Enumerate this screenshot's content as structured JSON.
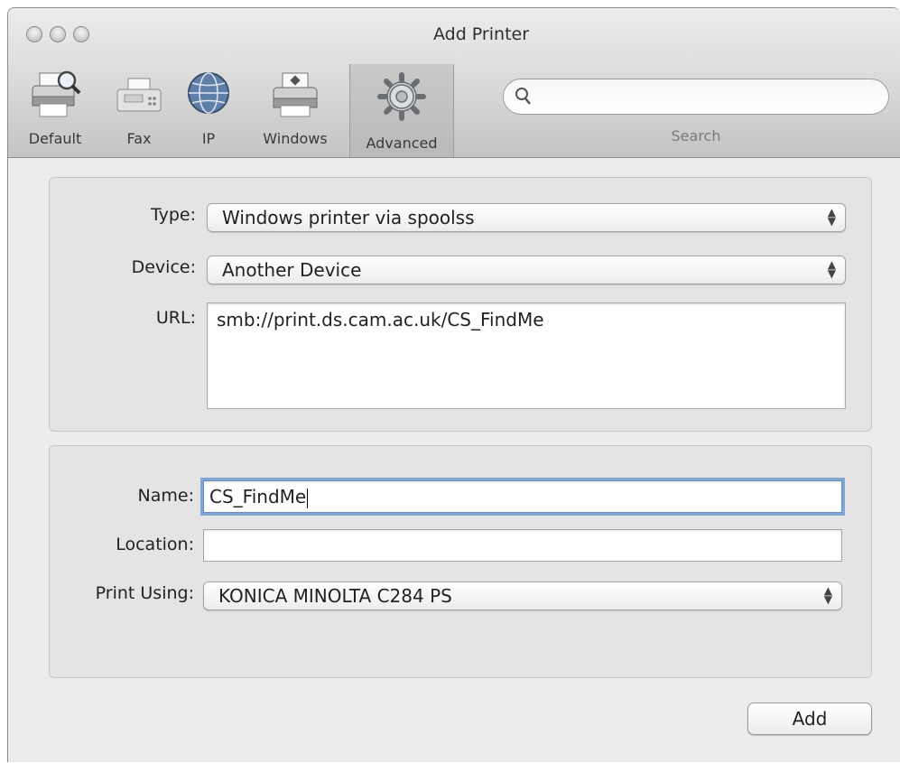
{
  "window": {
    "title": "Add Printer"
  },
  "toolbar": {
    "items": [
      {
        "label": "Default",
        "icon": "default-printer-icon"
      },
      {
        "label": "Fax",
        "icon": "fax-icon"
      },
      {
        "label": "IP",
        "icon": "ip-globe-icon"
      },
      {
        "label": "Windows",
        "icon": "windows-printer-icon"
      },
      {
        "label": "Advanced",
        "icon": "advanced-gear-icon",
        "selected": true
      }
    ],
    "search_label": "Search",
    "search_value": ""
  },
  "connection": {
    "type_label": "Type:",
    "type_value": "Windows printer via spoolss",
    "device_label": "Device:",
    "device_value": "Another Device",
    "url_label": "URL:",
    "url_value": "smb://print.ds.cam.ac.uk/CS_FindMe"
  },
  "details": {
    "name_label": "Name:",
    "name_value": "CS_FindMe",
    "location_label": "Location:",
    "location_value": "",
    "print_using_label": "Print Using:",
    "print_using_value": "KONICA MINOLTA C284 PS"
  },
  "actions": {
    "add_label": "Add"
  }
}
